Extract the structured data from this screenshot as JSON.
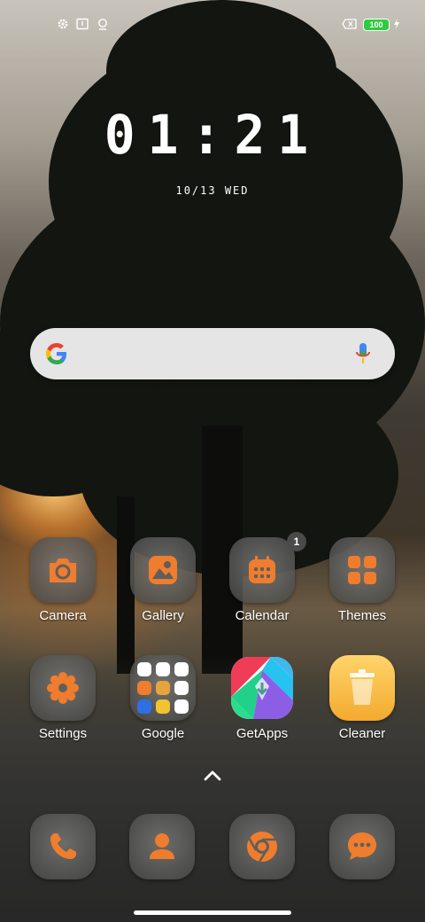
{
  "status_bar": {
    "left_icons": [
      "gear-icon",
      "notification-box-icon",
      "location-pin-icon"
    ],
    "right_icons": [
      "no-sim-icon",
      "battery-icon",
      "charging-bolt-icon"
    ],
    "battery_level": "100"
  },
  "lockclock": {
    "time": "01:21",
    "date": "10/13 WED"
  },
  "search": {
    "logo": "google-g-icon",
    "mic": "microphone-icon"
  },
  "apps": [
    {
      "label": "Camera",
      "icon": "camera-icon"
    },
    {
      "label": "Gallery",
      "icon": "gallery-icon"
    },
    {
      "label": "Calendar",
      "icon": "calendar-icon",
      "badge": "1"
    },
    {
      "label": "Themes",
      "icon": "themes-icon"
    },
    {
      "label": "Settings",
      "icon": "gear-icon"
    },
    {
      "label": "Google",
      "icon": "folder-icon"
    },
    {
      "label": "GetApps",
      "icon": "getapps-icon"
    },
    {
      "label": "Cleaner",
      "icon": "trash-can-icon"
    }
  ],
  "app_drawer": {
    "icon": "chevron-up-icon"
  },
  "dock": [
    {
      "icon": "phone-icon"
    },
    {
      "icon": "contacts-icon"
    },
    {
      "icon": "chrome-icon"
    },
    {
      "icon": "messages-icon"
    }
  ],
  "colors": {
    "accent": "#ef7d2d",
    "battery": "#2ecc40",
    "icon_bg": "#5f5f5d"
  }
}
